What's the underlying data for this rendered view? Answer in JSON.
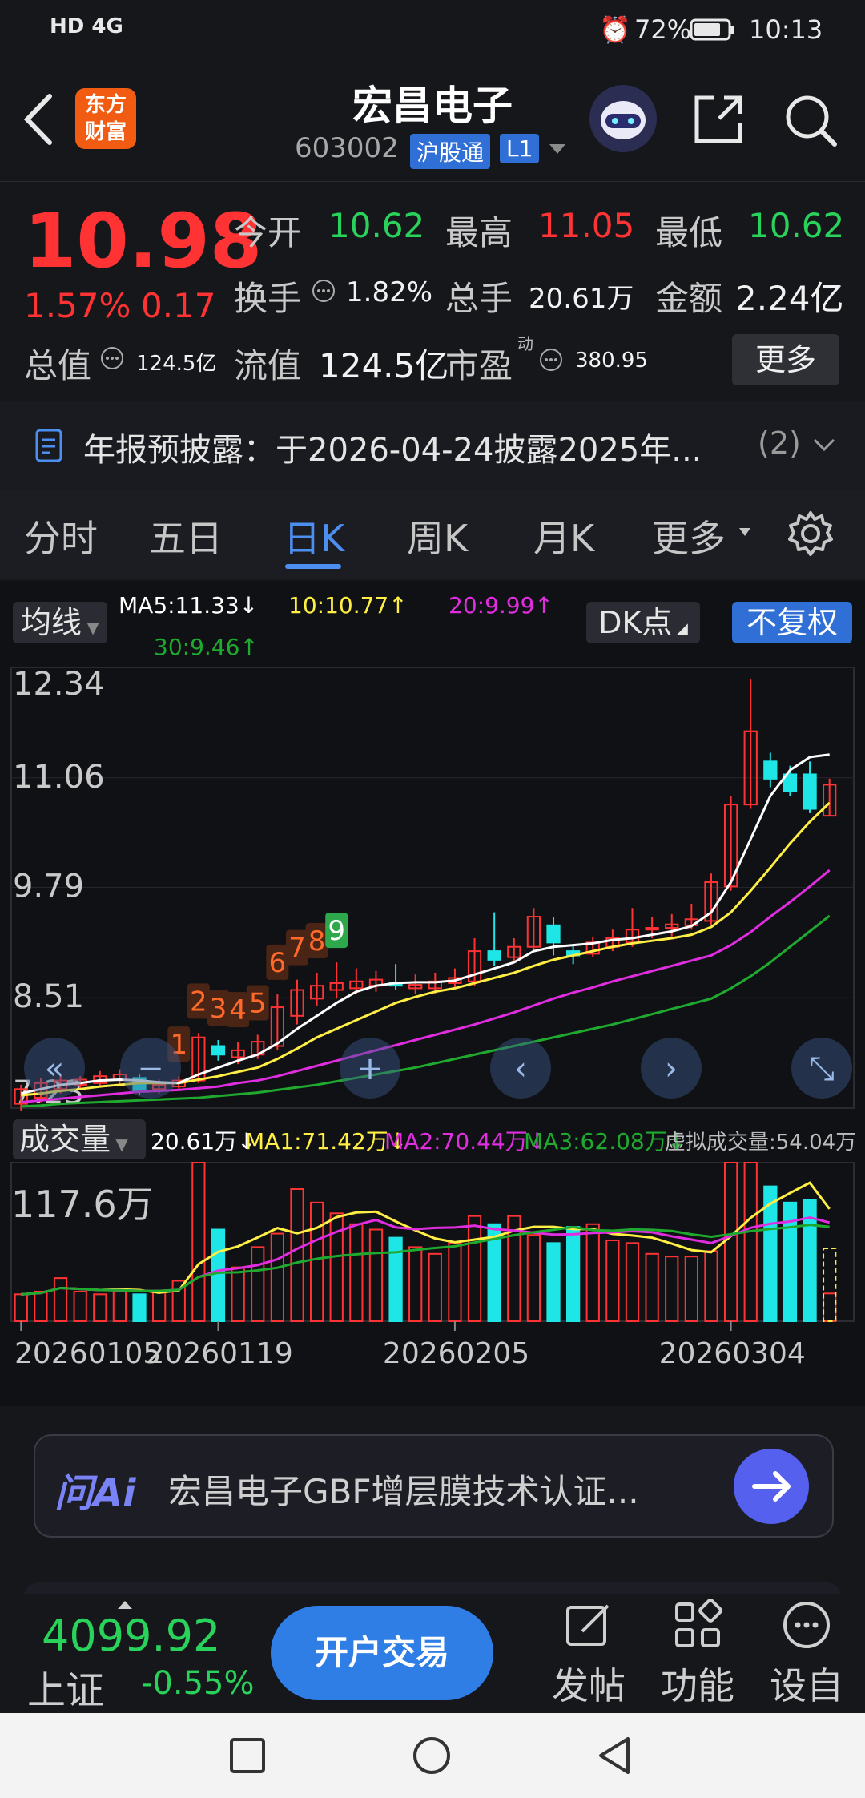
{
  "status_bar": {
    "network": "HD 4G",
    "battery": "72%",
    "time": "10:13"
  },
  "header": {
    "title": "宏昌电子",
    "code": "603002",
    "tag1": "沪股通",
    "tag2": "L1",
    "logo_line1": "东方",
    "logo_line2": "财富"
  },
  "quote": {
    "price": "10.98",
    "change_pct": "1.57%",
    "change_abs": "0.17",
    "open_label": "今开",
    "open": "10.62",
    "high_label": "最高",
    "high": "11.05",
    "low_label": "最低",
    "low": "10.62",
    "turnover_label": "换手",
    "turnover": "1.82%",
    "volume_label": "总手",
    "volume": "20.61万",
    "amount_label": "金额",
    "amount": "2.24亿",
    "mcap_label": "总值",
    "mcap": "124.5亿",
    "float_label": "流值",
    "float": "124.5亿",
    "pe_label": "市盈",
    "pe_sup": "动",
    "pe": "380.95",
    "more_button": "更多"
  },
  "notice": {
    "text": "年报预披露：于2026-04-24披露2025年...",
    "count": "(2)"
  },
  "tabs": [
    "分时",
    "五日",
    "日K",
    "周K",
    "月K",
    "更多"
  ],
  "active_tab": "日K",
  "chart_controls": {
    "ma_selector": "均线",
    "ma5": "MA5:11.33↓",
    "ma10": "10:10.77↑",
    "ma20": "20:9.99↑",
    "ma30": "30:9.46↑",
    "dk_button": "DK点",
    "adjust_button": "不复权",
    "vol_selector": "成交量",
    "vol_now": "20.61万↓",
    "vol_ma1": "MA1:71.42万↓",
    "vol_ma2": "MA2:70.44万↓",
    "vol_ma3": "MA3:62.08万↓",
    "vol_virtual": "虚拟成交量:54.04万",
    "vol_max_label": "117.6万"
  },
  "chart_data": {
    "type": "candlestick",
    "y_ticks": [
      "12.34",
      "11.06",
      "9.79",
      "8.51",
      "7.23"
    ],
    "ylim": [
      7.23,
      12.34
    ],
    "x_tick_labels": [
      "20260105",
      "20260119",
      "20260205",
      "20260304"
    ],
    "candles": [
      {
        "o": 7.28,
        "c": 7.45,
        "h": 7.5,
        "l": 7.2
      },
      {
        "o": 7.35,
        "c": 7.52,
        "h": 7.58,
        "l": 7.3
      },
      {
        "o": 7.45,
        "c": 7.55,
        "h": 7.62,
        "l": 7.4
      },
      {
        "o": 7.5,
        "c": 7.56,
        "h": 7.6,
        "l": 7.45
      },
      {
        "o": 7.52,
        "c": 7.6,
        "h": 7.66,
        "l": 7.48
      },
      {
        "o": 7.56,
        "c": 7.62,
        "h": 7.68,
        "l": 7.5
      },
      {
        "o": 7.58,
        "c": 7.42,
        "h": 7.62,
        "l": 7.38
      },
      {
        "o": 7.45,
        "c": 7.5,
        "h": 7.56,
        "l": 7.4
      },
      {
        "o": 7.48,
        "c": 7.55,
        "h": 7.6,
        "l": 7.44
      },
      {
        "o": 7.55,
        "c": 8.05,
        "h": 8.1,
        "l": 7.52
      },
      {
        "o": 7.95,
        "c": 7.85,
        "h": 8.02,
        "l": 7.78
      },
      {
        "o": 7.82,
        "c": 7.9,
        "h": 8.0,
        "l": 7.74
      },
      {
        "o": 7.85,
        "c": 8.0,
        "h": 8.08,
        "l": 7.8
      },
      {
        "o": 7.95,
        "c": 8.4,
        "h": 8.55,
        "l": 7.9
      },
      {
        "o": 8.3,
        "c": 8.6,
        "h": 8.72,
        "l": 8.2
      },
      {
        "o": 8.5,
        "c": 8.65,
        "h": 8.8,
        "l": 8.42
      },
      {
        "o": 8.6,
        "c": 8.68,
        "h": 8.92,
        "l": 8.5
      },
      {
        "o": 8.62,
        "c": 8.7,
        "h": 8.85,
        "l": 8.55
      },
      {
        "o": 8.65,
        "c": 8.72,
        "h": 8.82,
        "l": 8.58
      },
      {
        "o": 8.68,
        "c": 8.65,
        "h": 8.9,
        "l": 8.6
      },
      {
        "o": 8.62,
        "c": 8.66,
        "h": 8.78,
        "l": 8.55
      },
      {
        "o": 8.62,
        "c": 8.7,
        "h": 8.8,
        "l": 8.55
      },
      {
        "o": 8.68,
        "c": 8.74,
        "h": 8.85,
        "l": 8.62
      },
      {
        "o": 8.7,
        "c": 9.05,
        "h": 9.2,
        "l": 8.65
      },
      {
        "o": 9.05,
        "c": 8.95,
        "h": 9.5,
        "l": 8.88
      },
      {
        "o": 8.98,
        "c": 9.1,
        "h": 9.2,
        "l": 8.92
      },
      {
        "o": 9.1,
        "c": 9.45,
        "h": 9.55,
        "l": 9.05
      },
      {
        "o": 9.35,
        "c": 9.15,
        "h": 9.45,
        "l": 9.0
      },
      {
        "o": 9.05,
        "c": 9.0,
        "h": 9.12,
        "l": 8.9
      },
      {
        "o": 9.02,
        "c": 9.15,
        "h": 9.22,
        "l": 8.98
      },
      {
        "o": 9.1,
        "c": 9.2,
        "h": 9.3,
        "l": 9.05
      },
      {
        "o": 9.15,
        "c": 9.3,
        "h": 9.55,
        "l": 9.1
      },
      {
        "o": 9.3,
        "c": 9.32,
        "h": 9.45,
        "l": 9.2
      },
      {
        "o": 9.32,
        "c": 9.36,
        "h": 9.48,
        "l": 9.22
      },
      {
        "o": 9.35,
        "c": 9.42,
        "h": 9.6,
        "l": 9.3
      },
      {
        "o": 9.4,
        "c": 9.85,
        "h": 9.95,
        "l": 9.35
      },
      {
        "o": 9.8,
        "c": 10.75,
        "h": 10.85,
        "l": 9.75
      },
      {
        "o": 10.75,
        "c": 11.6,
        "h": 12.2,
        "l": 10.7
      },
      {
        "o": 11.25,
        "c": 11.05,
        "h": 11.35,
        "l": 10.95
      },
      {
        "o": 11.1,
        "c": 10.9,
        "h": 11.2,
        "l": 10.85
      },
      {
        "o": 11.1,
        "c": 10.7,
        "h": 11.25,
        "l": 10.65
      },
      {
        "o": 10.62,
        "c": 10.98,
        "h": 11.05,
        "l": 10.62
      }
    ],
    "ma5": [
      7.4,
      7.45,
      7.5,
      7.52,
      7.55,
      7.56,
      7.55,
      7.53,
      7.52,
      7.62,
      7.7,
      7.78,
      7.85,
      7.98,
      8.15,
      8.3,
      8.45,
      8.58,
      8.65,
      8.68,
      8.69,
      8.69,
      8.71,
      8.78,
      8.85,
      8.92,
      9.05,
      9.1,
      9.12,
      9.14,
      9.18,
      9.2,
      9.24,
      9.28,
      9.34,
      9.5,
      9.85,
      10.35,
      10.85,
      11.15,
      11.3,
      11.33
    ],
    "ma10": [
      7.38,
      7.4,
      7.43,
      7.45,
      7.48,
      7.5,
      7.52,
      7.52,
      7.52,
      7.56,
      7.6,
      7.65,
      7.7,
      7.8,
      7.92,
      8.05,
      8.15,
      8.25,
      8.35,
      8.45,
      8.52,
      8.58,
      8.62,
      8.68,
      8.74,
      8.8,
      8.88,
      8.95,
      9.0,
      9.05,
      9.1,
      9.14,
      9.17,
      9.2,
      9.24,
      9.33,
      9.5,
      9.75,
      10.02,
      10.3,
      10.55,
      10.77
    ],
    "ma20": [
      7.3,
      7.32,
      7.34,
      7.36,
      7.38,
      7.4,
      7.42,
      7.43,
      7.44,
      7.46,
      7.48,
      7.52,
      7.55,
      7.6,
      7.66,
      7.72,
      7.78,
      7.84,
      7.9,
      7.96,
      8.02,
      8.08,
      8.14,
      8.2,
      8.27,
      8.34,
      8.42,
      8.5,
      8.57,
      8.63,
      8.7,
      8.76,
      8.82,
      8.88,
      8.94,
      9.0,
      9.12,
      9.27,
      9.45,
      9.62,
      9.8,
      9.99
    ],
    "ma30": [
      7.25,
      7.26,
      7.28,
      7.29,
      7.3,
      7.31,
      7.32,
      7.33,
      7.34,
      7.35,
      7.37,
      7.39,
      7.41,
      7.44,
      7.47,
      7.5,
      7.54,
      7.58,
      7.62,
      7.66,
      7.7,
      7.75,
      7.8,
      7.85,
      7.9,
      7.95,
      8.0,
      8.05,
      8.1,
      8.15,
      8.2,
      8.26,
      8.32,
      8.38,
      8.44,
      8.5,
      8.62,
      8.76,
      8.92,
      9.1,
      9.28,
      9.46
    ],
    "volumes": [
      20,
      22,
      32,
      22,
      20,
      22,
      20,
      22,
      30,
      117.6,
      68,
      40,
      55,
      65,
      98,
      88,
      80,
      72,
      68,
      62,
      55,
      50,
      58,
      78,
      72,
      78,
      64,
      58,
      70,
      72,
      60,
      58,
      50,
      48,
      48,
      52,
      117.6,
      117.6,
      100,
      88,
      90,
      20.61
    ],
    "vol_virtual": 54.04
  },
  "chart_overlay_nums": [
    "1",
    "2",
    "3",
    "4",
    "5",
    "6",
    "7",
    "8",
    "9"
  ],
  "ai_bar": {
    "brand": "问Ai",
    "text": "宏昌电子GBF增层膜技术认证..."
  },
  "bottom": {
    "index_value": "4099.92",
    "index_name": "上证",
    "index_change": "-0.55%",
    "trade_button": "开户交易",
    "post": "发帖",
    "func": "功能",
    "settings": "设自"
  },
  "colors": {
    "up": "#ff3333",
    "down": "#1fe6e6",
    "ma5": "#ffffff",
    "ma10": "#ffee44",
    "ma20": "#e02de0",
    "ma30": "#1faa2f",
    "accent": "#2f6fd6"
  }
}
